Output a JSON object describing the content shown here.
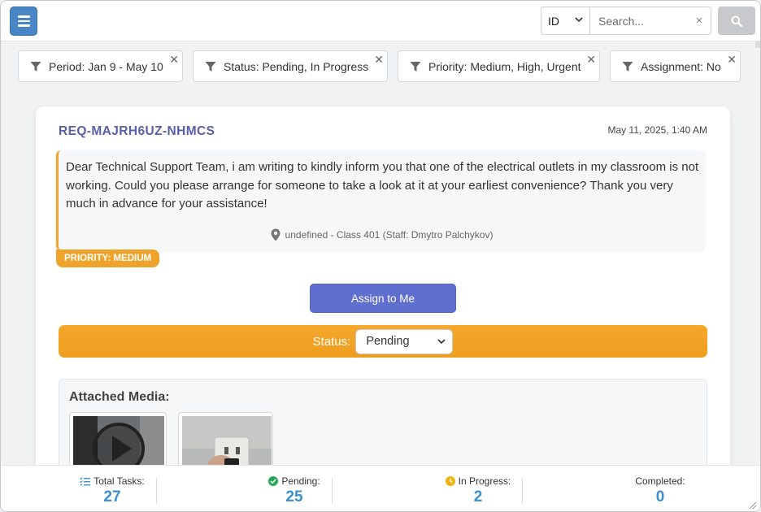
{
  "search": {
    "type_value": "ID",
    "placeholder": "Search...",
    "clear_symbol": "×"
  },
  "filters": [
    {
      "label": "Period: Jan 9 - May 10"
    },
    {
      "label": "Status: Pending, In Progress"
    },
    {
      "label": "Priority: Medium, High, Urgent"
    },
    {
      "label": "Assignment: No"
    }
  ],
  "chip_close_symbol": "✕",
  "request": {
    "id": "REQ-MAJRH6UZ-NHMCS",
    "date": "May 11, 2025, 1:40 AM",
    "message": "Dear Technical Support Team, i am writing to kindly inform you that one of the electrical outlets in my classroom is not working. Could you please arrange for someone to take a look at it at your earliest convenience? Thank you very much in advance for your assistance!",
    "location": "undefined - Class 401 (Staff: Dmytro Palchykov)",
    "priority_badge": "PRIORITY: MEDIUM",
    "assign_label": "Assign to Me",
    "status_label": "Status:",
    "status_value": "Pending",
    "media_title": "Attached Media:"
  },
  "stats": {
    "total_label": "Total Tasks:",
    "total_value": "27",
    "pending_label": "Pending:",
    "pending_value": "25",
    "in_progress_label": "In Progress:",
    "in_progress_value": "2",
    "completed_label": "Completed:",
    "completed_value": "0"
  },
  "colors": {
    "primary": "#4a86c5",
    "accent_orange": "#f0a32a",
    "assign_button": "#5e6fcf",
    "stat_value": "#3b8ed2",
    "request_id": "#5b5ea8"
  }
}
